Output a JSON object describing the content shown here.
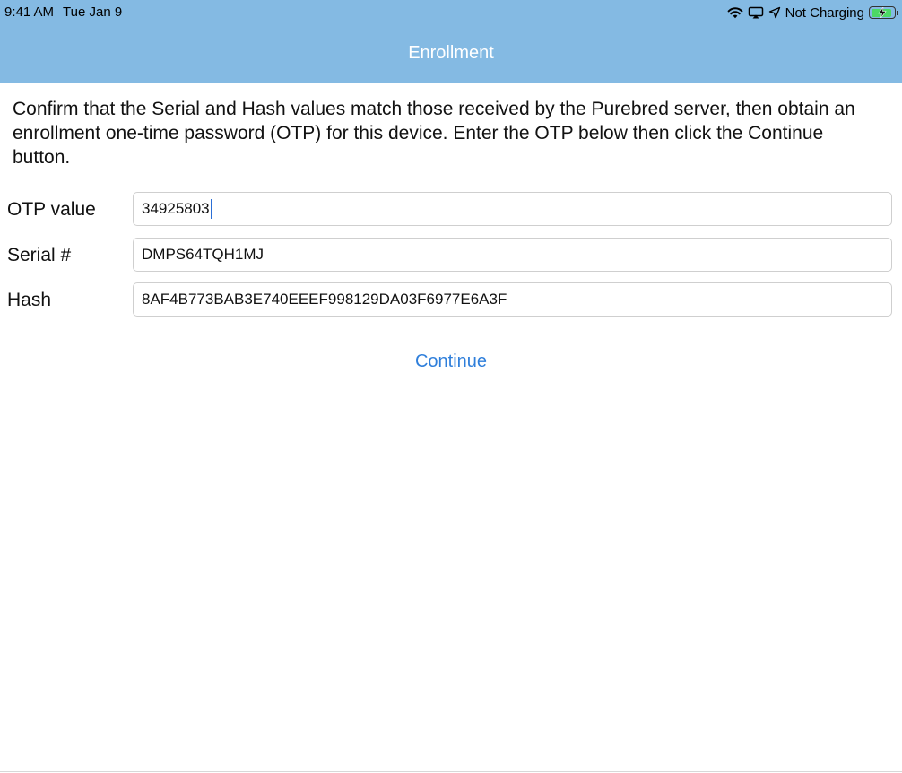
{
  "status_bar": {
    "time": "9:41 AM",
    "date": "Tue Jan 9",
    "charging_text": "Not Charging",
    "battery_level": 0.9,
    "icons": [
      "wifi-icon",
      "airplay-icon",
      "location-icon",
      "battery-icon"
    ]
  },
  "nav": {
    "title": "Enrollment"
  },
  "instructions": "Confirm that the Serial and Hash values match those received by the Purebred server, then obtain an enrollment one-time password (OTP) for this device. Enter the OTP below then click the Continue button.",
  "form": {
    "otp": {
      "label": "OTP value",
      "value": "34925803"
    },
    "serial": {
      "label": "Serial #",
      "value": "DMPS64TQH1MJ"
    },
    "hash": {
      "label": "Hash",
      "value": "8AF4B773BAB3E740EEEF998129DA03F6977E6A3F"
    }
  },
  "actions": {
    "continue_label": "Continue"
  },
  "colors": {
    "header_bg": "#84BAE3",
    "accent": "#2F7FDB",
    "battery_fill": "#4CD964"
  }
}
